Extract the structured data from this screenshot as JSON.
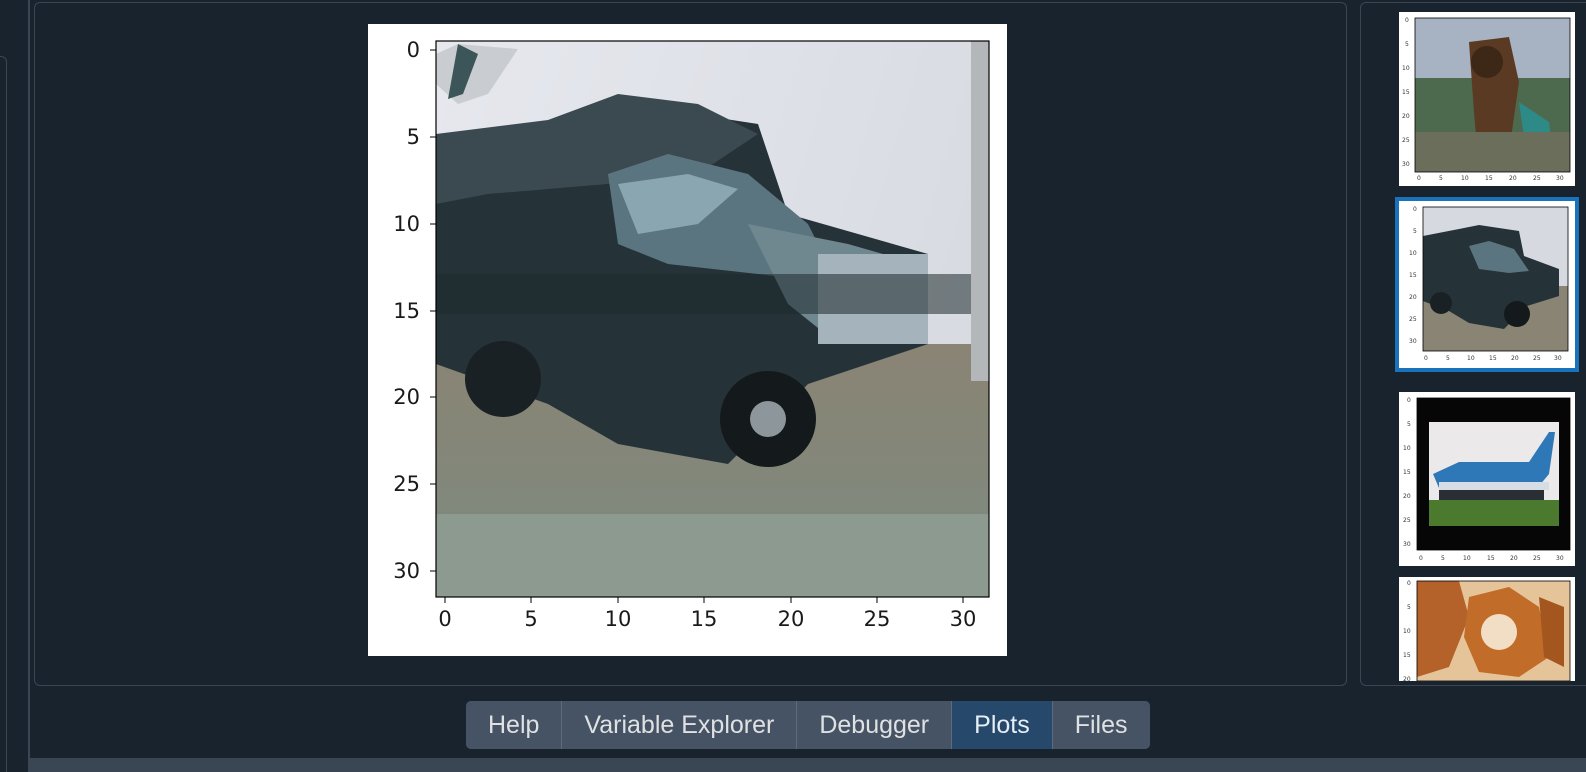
{
  "plot_main": {
    "y_ticks": [
      "0",
      "5",
      "10",
      "15",
      "20",
      "25",
      "30"
    ],
    "x_ticks": [
      "0",
      "5",
      "10",
      "15",
      "20",
      "25",
      "30"
    ],
    "image_subject": "dump truck"
  },
  "thumbnails": [
    {
      "subject": "bird/ostrich",
      "selected": false
    },
    {
      "subject": "dump truck",
      "selected": true
    },
    {
      "subject": "airplane",
      "selected": false
    },
    {
      "subject": "dog",
      "selected": false
    }
  ],
  "tabs": [
    {
      "label": "Help",
      "active": false
    },
    {
      "label": "Variable Explorer",
      "active": false
    },
    {
      "label": "Debugger",
      "active": false
    },
    {
      "label": "Plots",
      "active": true
    },
    {
      "label": "Files",
      "active": false
    }
  ],
  "colors": {
    "background": "#19232d",
    "border": "#3b4654",
    "tab": "#455364",
    "tab_active": "#26486b",
    "selection": "#1a72bb"
  }
}
